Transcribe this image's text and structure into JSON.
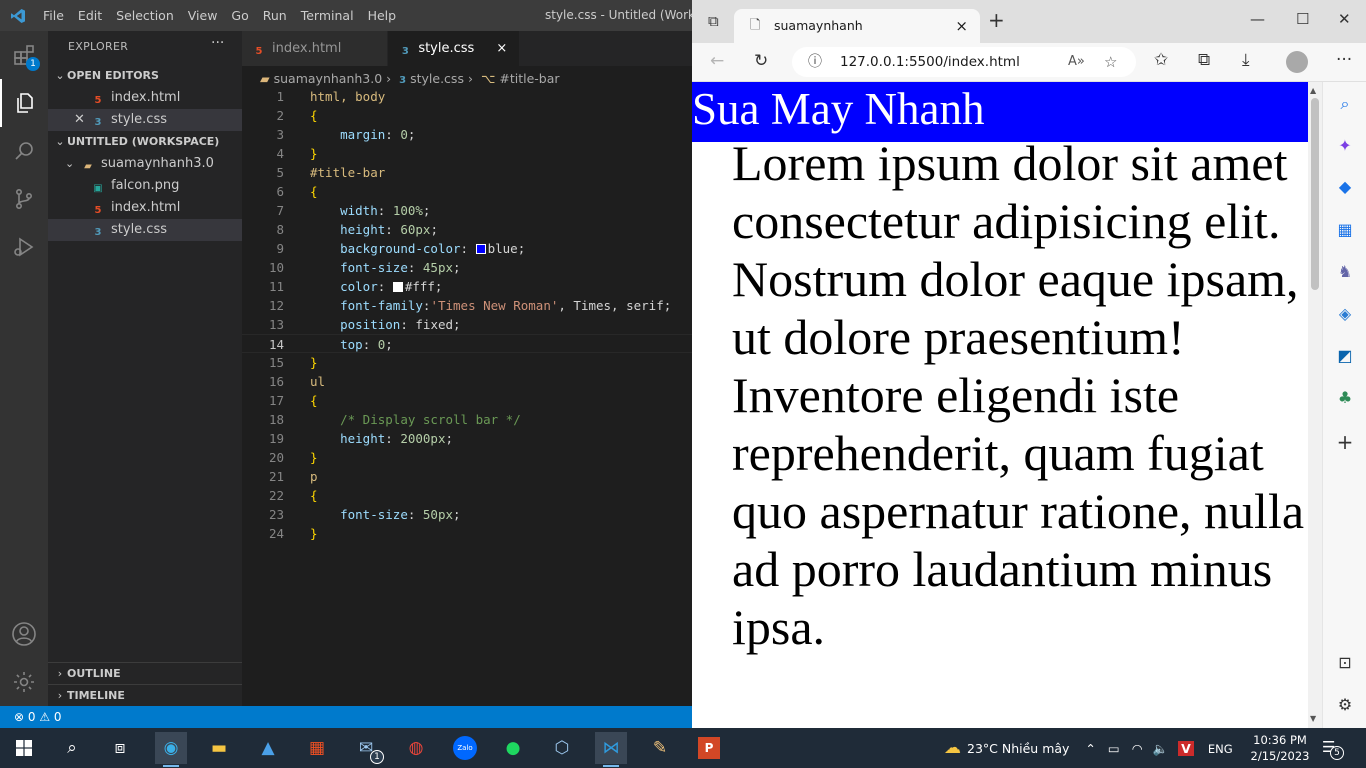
{
  "vscode": {
    "menu": [
      "File",
      "Edit",
      "Selection",
      "View",
      "Go",
      "Run",
      "Terminal",
      "Help"
    ],
    "window_title": "style.css - Untitled (Workspa",
    "explorer": {
      "title": "EXPLORER",
      "more": "···",
      "open_editors_label": "OPEN EDITORS",
      "open_editors": [
        "index.html",
        "style.css"
      ],
      "workspace_label": "UNTITLED (WORKSPACE)",
      "folder": "suamaynhanh3.0",
      "files": [
        "falcon.png",
        "index.html",
        "style.css"
      ],
      "outline_label": "OUTLINE",
      "timeline_label": "TIMELINE",
      "badge": "1"
    },
    "tabs": [
      {
        "label": "index.html",
        "type": "html"
      },
      {
        "label": "style.css",
        "type": "css",
        "close": "×"
      }
    ],
    "breadcrumb": [
      "suamaynhanh3.0",
      "style.css",
      "#title-bar"
    ],
    "line_numbers": [
      "1",
      "2",
      "3",
      "4",
      "5",
      "6",
      "7",
      "8",
      "9",
      "10",
      "11",
      "12",
      "13",
      "14",
      "15",
      "16",
      "17",
      "18",
      "19",
      "20",
      "21",
      "22",
      "23",
      "24"
    ],
    "code": {
      "l1_sel": "html, body",
      "l2": "{",
      "l3_prop": "margin",
      "l3_val": "0",
      "l4": "}",
      "l5_sel": "#title-bar",
      "l6": "{",
      "l7_prop": "width",
      "l7_val": "100%",
      "l8_prop": "height",
      "l8_val": "60px",
      "l9_prop": "background-color",
      "l9_val": "blue",
      "l10_prop": "font-size",
      "l10_val": "45px",
      "l11_prop": "color",
      "l11_val": "#fff",
      "l12_prop": "font-family",
      "l12_str": "'Times New Roman'",
      "l12_rest": ", Times, serif",
      "l13_prop": "position",
      "l13_val": "fixed",
      "l14_prop": "top",
      "l14_val": "0",
      "l15": "}",
      "l16_sel": "ul",
      "l17": "{",
      "l18_cm": "/* Display scroll bar */",
      "l19_prop": "height",
      "l19_val": "2000px",
      "l20": "}",
      "l21_sel": "p",
      "l22": "{",
      "l23_prop": "font-size",
      "l23_val": "50px",
      "l24": "}"
    },
    "status": "⊗ 0 ⚠ 0"
  },
  "browser": {
    "tab_title": "suamaynhanh",
    "tab_close": "×",
    "new_tab": "+",
    "url": "127.0.0.1:5500/index.html",
    "page_title": "Sua May Nhanh",
    "paragraph": "Lorem ipsum dolor sit amet consectetur adipisicing elit. Nostrum dolor eaque ipsam, ut dolore praesentium! Inventore eligendi iste reprehenderit, quam fugiat quo aspernatur ratione, nulla ad porro laudantium minus ipsa."
  },
  "taskbar": {
    "weather": "23°C  Nhiều mây",
    "lang": "ENG",
    "time": "10:36 PM",
    "date": "2/15/2023",
    "mail_badge": "1",
    "notif_count": "5"
  },
  "colors": {
    "vs_accent": "#007acc",
    "title_bar_bg": "#0000ff"
  }
}
